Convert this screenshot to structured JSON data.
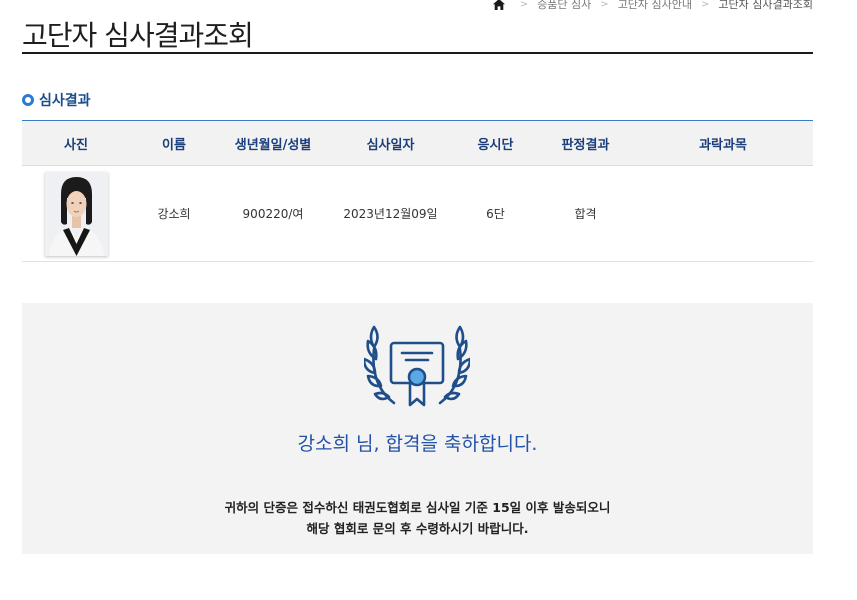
{
  "breadcrumb": {
    "home_icon": "home-icon",
    "items": [
      "승품단 심사",
      "고단자 심사안내",
      "고단자 심사결과조회"
    ]
  },
  "page_title": "고단자 심사결과조회",
  "section": {
    "title": "심사결과"
  },
  "table": {
    "headers": {
      "photo": "사진",
      "name": "이름",
      "birth_gender": "생년월일/성별",
      "exam_date": "심사일자",
      "dan": "응시단",
      "result": "판정결과",
      "failed_subjects": "과락과목"
    },
    "rows": [
      {
        "name": "강소희",
        "birth_gender": "900220/여",
        "exam_date": "2023년12월09일",
        "dan": "6단",
        "result": "합격",
        "failed_subjects": ""
      }
    ]
  },
  "congrats": {
    "icon": "laurel-certificate-icon",
    "message": "강소희 님, 합격을 축하합니다.",
    "notice_line1": "귀하의 단증은 접수하신 태권도협회로 심사일 기준 15일 이후 발송되오니",
    "notice_line2": "해당 협회로 문의 후 수령하시기 바랍니다."
  },
  "colors": {
    "accent_blue": "#2452a8",
    "header_text": "#1a3e7a",
    "bullet": "#2d7ad6",
    "panel_bg": "#f3f3f3"
  }
}
